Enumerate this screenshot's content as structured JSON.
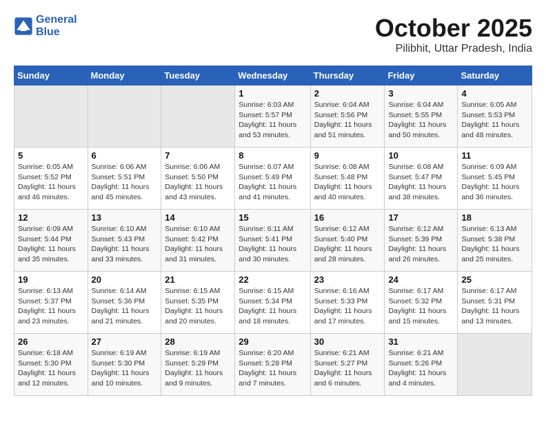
{
  "header": {
    "logo_line1": "General",
    "logo_line2": "Blue",
    "month": "October 2025",
    "location": "Pilibhit, Uttar Pradesh, India"
  },
  "weekdays": [
    "Sunday",
    "Monday",
    "Tuesday",
    "Wednesday",
    "Thursday",
    "Friday",
    "Saturday"
  ],
  "weeks": [
    [
      {
        "day": "",
        "info": ""
      },
      {
        "day": "",
        "info": ""
      },
      {
        "day": "",
        "info": ""
      },
      {
        "day": "1",
        "info": "Sunrise: 6:03 AM\nSunset: 5:57 PM\nDaylight: 11 hours\nand 53 minutes."
      },
      {
        "day": "2",
        "info": "Sunrise: 6:04 AM\nSunset: 5:56 PM\nDaylight: 11 hours\nand 51 minutes."
      },
      {
        "day": "3",
        "info": "Sunrise: 6:04 AM\nSunset: 5:55 PM\nDaylight: 11 hours\nand 50 minutes."
      },
      {
        "day": "4",
        "info": "Sunrise: 6:05 AM\nSunset: 5:53 PM\nDaylight: 11 hours\nand 48 minutes."
      }
    ],
    [
      {
        "day": "5",
        "info": "Sunrise: 6:05 AM\nSunset: 5:52 PM\nDaylight: 11 hours\nand 46 minutes."
      },
      {
        "day": "6",
        "info": "Sunrise: 6:06 AM\nSunset: 5:51 PM\nDaylight: 11 hours\nand 45 minutes."
      },
      {
        "day": "7",
        "info": "Sunrise: 6:06 AM\nSunset: 5:50 PM\nDaylight: 11 hours\nand 43 minutes."
      },
      {
        "day": "8",
        "info": "Sunrise: 6:07 AM\nSunset: 5:49 PM\nDaylight: 11 hours\nand 41 minutes."
      },
      {
        "day": "9",
        "info": "Sunrise: 6:08 AM\nSunset: 5:48 PM\nDaylight: 11 hours\nand 40 minutes."
      },
      {
        "day": "10",
        "info": "Sunrise: 6:08 AM\nSunset: 5:47 PM\nDaylight: 11 hours\nand 38 minutes."
      },
      {
        "day": "11",
        "info": "Sunrise: 6:09 AM\nSunset: 5:45 PM\nDaylight: 11 hours\nand 36 minutes."
      }
    ],
    [
      {
        "day": "12",
        "info": "Sunrise: 6:09 AM\nSunset: 5:44 PM\nDaylight: 11 hours\nand 35 minutes."
      },
      {
        "day": "13",
        "info": "Sunrise: 6:10 AM\nSunset: 5:43 PM\nDaylight: 11 hours\nand 33 minutes."
      },
      {
        "day": "14",
        "info": "Sunrise: 6:10 AM\nSunset: 5:42 PM\nDaylight: 11 hours\nand 31 minutes."
      },
      {
        "day": "15",
        "info": "Sunrise: 6:11 AM\nSunset: 5:41 PM\nDaylight: 11 hours\nand 30 minutes."
      },
      {
        "day": "16",
        "info": "Sunrise: 6:12 AM\nSunset: 5:40 PM\nDaylight: 11 hours\nand 28 minutes."
      },
      {
        "day": "17",
        "info": "Sunrise: 6:12 AM\nSunset: 5:39 PM\nDaylight: 11 hours\nand 26 minutes."
      },
      {
        "day": "18",
        "info": "Sunrise: 6:13 AM\nSunset: 5:38 PM\nDaylight: 11 hours\nand 25 minutes."
      }
    ],
    [
      {
        "day": "19",
        "info": "Sunrise: 6:13 AM\nSunset: 5:37 PM\nDaylight: 11 hours\nand 23 minutes."
      },
      {
        "day": "20",
        "info": "Sunrise: 6:14 AM\nSunset: 5:36 PM\nDaylight: 11 hours\nand 21 minutes."
      },
      {
        "day": "21",
        "info": "Sunrise: 6:15 AM\nSunset: 5:35 PM\nDaylight: 11 hours\nand 20 minutes."
      },
      {
        "day": "22",
        "info": "Sunrise: 6:15 AM\nSunset: 5:34 PM\nDaylight: 11 hours\nand 18 minutes."
      },
      {
        "day": "23",
        "info": "Sunrise: 6:16 AM\nSunset: 5:33 PM\nDaylight: 11 hours\nand 17 minutes."
      },
      {
        "day": "24",
        "info": "Sunrise: 6:17 AM\nSunset: 5:32 PM\nDaylight: 11 hours\nand 15 minutes."
      },
      {
        "day": "25",
        "info": "Sunrise: 6:17 AM\nSunset: 5:31 PM\nDaylight: 11 hours\nand 13 minutes."
      }
    ],
    [
      {
        "day": "26",
        "info": "Sunrise: 6:18 AM\nSunset: 5:30 PM\nDaylight: 11 hours\nand 12 minutes."
      },
      {
        "day": "27",
        "info": "Sunrise: 6:19 AM\nSunset: 5:30 PM\nDaylight: 11 hours\nand 10 minutes."
      },
      {
        "day": "28",
        "info": "Sunrise: 6:19 AM\nSunset: 5:29 PM\nDaylight: 11 hours\nand 9 minutes."
      },
      {
        "day": "29",
        "info": "Sunrise: 6:20 AM\nSunset: 5:28 PM\nDaylight: 11 hours\nand 7 minutes."
      },
      {
        "day": "30",
        "info": "Sunrise: 6:21 AM\nSunset: 5:27 PM\nDaylight: 11 hours\nand 6 minutes."
      },
      {
        "day": "31",
        "info": "Sunrise: 6:21 AM\nSunset: 5:26 PM\nDaylight: 11 hours\nand 4 minutes."
      },
      {
        "day": "",
        "info": ""
      }
    ]
  ]
}
